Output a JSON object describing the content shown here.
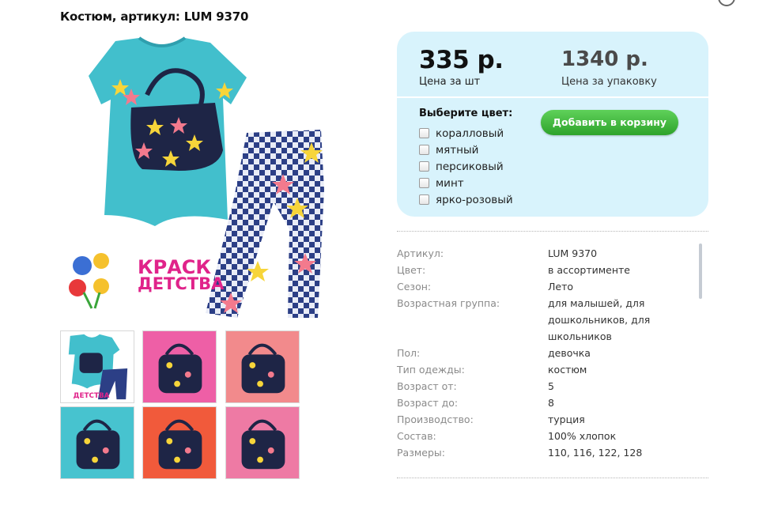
{
  "title": "Костюм, артикул: LUM 9370",
  "logo": {
    "text_top": "КРАСК",
    "text_bottom": "ДЕТСТВА"
  },
  "thumbnails": [
    {
      "bg": "#42bfcc",
      "variant": "full"
    },
    {
      "bg": "#ee5fa6",
      "variant": "closeup"
    },
    {
      "bg": "#f28a8c",
      "variant": "closeup"
    },
    {
      "bg": "#47c3cf",
      "variant": "closeup"
    },
    {
      "bg": "#f15a3b",
      "variant": "closeup"
    },
    {
      "bg": "#ee7aa4",
      "variant": "closeup"
    }
  ],
  "price": {
    "unit": "335 р.",
    "unit_caption": "Цена за шт",
    "pack": "1340 р.",
    "pack_caption": "Цена за упаковку"
  },
  "colors": {
    "title": "Выберите цвет:",
    "options": [
      "коралловый",
      "мятный",
      "персиковый",
      "минт",
      "ярко-розовый"
    ]
  },
  "cart_button": "Добавить в корзину",
  "specs": [
    {
      "key": "Артикул:",
      "value": "LUM 9370"
    },
    {
      "key": "Цвет:",
      "value": "в ассортименте"
    },
    {
      "key": "Сезон:",
      "value": "Лето"
    },
    {
      "key": "Возрастная группа:",
      "value": "для малышей, для дошкольников, для школьников"
    },
    {
      "key": "Пол:",
      "value": "девочка"
    },
    {
      "key": "Тип одежды:",
      "value": "костюм"
    },
    {
      "key": "Возраст от:",
      "value": "5"
    },
    {
      "key": "Возраст до:",
      "value": "8"
    },
    {
      "key": "Производство:",
      "value": "турция"
    },
    {
      "key": "Состав:",
      "value": "100% хлопок"
    },
    {
      "key": "Размеры:",
      "value": "110, 116, 122, 128"
    }
  ],
  "theme": {
    "accent_green": "#34a82f",
    "price_bg": "#d8f3fc",
    "shirt": "#42bfcc"
  }
}
